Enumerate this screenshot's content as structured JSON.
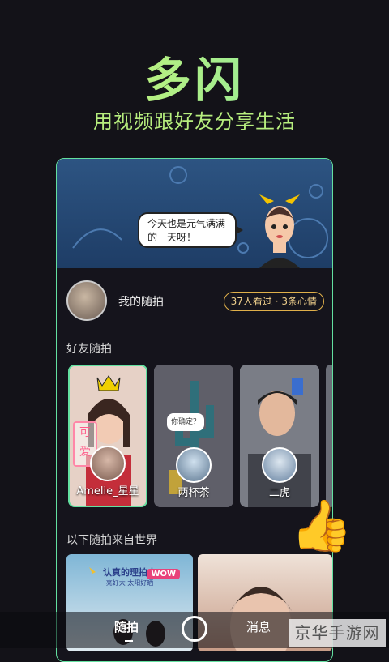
{
  "hero": {
    "title": "多闪",
    "subtitle": "用视频跟好友分享生活"
  },
  "banner": {
    "bubble": "今天也是元气满满的一天呀！"
  },
  "me": {
    "label": "我的随拍",
    "stats": "37人看过 · 3条心情"
  },
  "friends": {
    "title": "好友随拍",
    "cards": [
      {
        "name": "Amelie_星星",
        "tag": "可爱"
      },
      {
        "name": "两杯茶",
        "bubble": "你确定？"
      },
      {
        "name": "二虎"
      }
    ]
  },
  "world": {
    "title": "以下随拍来自世界",
    "banner_text": "认真的理拍中",
    "sub_text": "亮好大 太阳好晒",
    "wow": "WOW"
  },
  "nav": {
    "left": "随拍",
    "right": "消息"
  },
  "watermark": "京华手游网",
  "colors": {
    "accent": "#63e0a0",
    "title_gradient_start": "#d8f46a",
    "pill_border": "#e0b04a"
  }
}
